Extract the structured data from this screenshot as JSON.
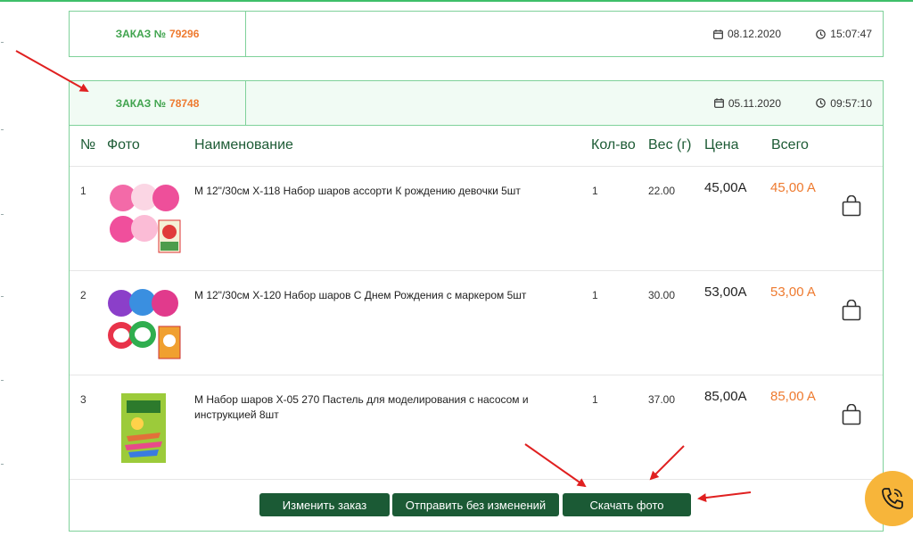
{
  "orders": [
    {
      "label": "ЗАКАЗ №",
      "number": "79296",
      "date": "08.12.2020",
      "time": "15:07:47"
    },
    {
      "label": "ЗАКАЗ №",
      "number": "78748",
      "date": "05.11.2020",
      "time": "09:57:10"
    }
  ],
  "table": {
    "headers": [
      "№",
      "Фото",
      "Наименование",
      "Кол-во",
      "Вес (г)",
      "Цена",
      "Всего"
    ],
    "rows": [
      {
        "index": "1",
        "name": "М 12\"/30см Х-118 Набор шаров ассорти К рождению девочки 5шт",
        "qty": "1",
        "weight": "22.00",
        "price": "45,00A",
        "total": "45,00 A"
      },
      {
        "index": "2",
        "name": "М 12\"/30см Х-120 Набор шаров С Днем Рождения с маркером 5шт",
        "qty": "1",
        "weight": "30.00",
        "price": "53,00A",
        "total": "53,00 A"
      },
      {
        "index": "3",
        "name": "М Набор шаров Х-05 270 Пастель для моделирования с насосом и инструкцией 8шт",
        "qty": "1",
        "weight": "37.00",
        "price": "85,00A",
        "total": "85,00 A"
      }
    ]
  },
  "actions": {
    "edit": "Изменить заказ",
    "send": "Отправить без изменений",
    "download": "Скачать фото"
  },
  "colors": {
    "accent_green": "#3fa34d",
    "border_green": "#7fd19a",
    "button_green": "#1b5a35",
    "orange": "#ee7a2f",
    "call_button": "#f7b53a",
    "arrow_red": "#e02020"
  },
  "icons": {
    "date": "calendar-icon",
    "time": "clock-icon",
    "cart": "shopping-bag-icon",
    "call": "phone-call-icon"
  }
}
